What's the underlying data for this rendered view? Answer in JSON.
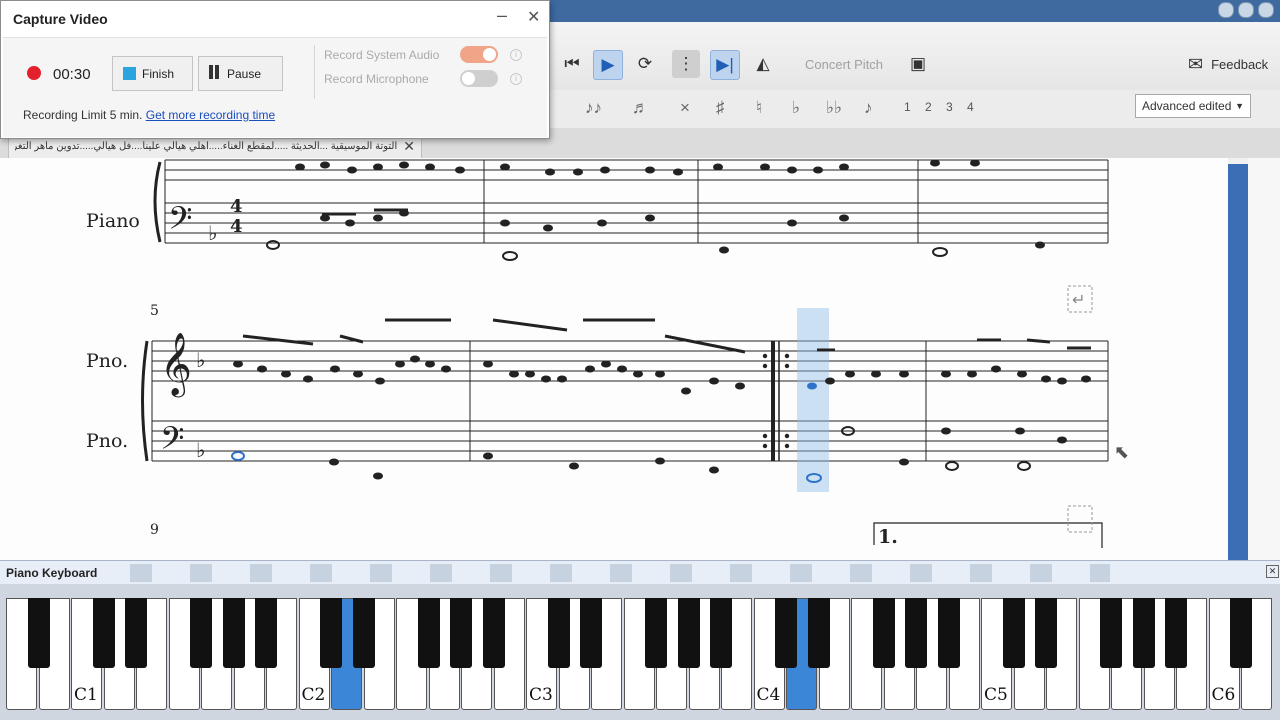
{
  "toolbar": {
    "concert_pitch": "Concert Pitch",
    "feedback": "Feedback",
    "mode_select": "Advanced edited",
    "voice_numbers": [
      "1",
      "2",
      "3",
      "4"
    ],
    "icons": [
      "rewind-to-start-icon",
      "play-icon",
      "loop-icon",
      "repeat-icon",
      "next-icon",
      "metronome-icon",
      "camera-icon",
      "envelope-icon"
    ]
  },
  "tab": {
    "title": "التوتة الموسيقية ...الحديثة .....لمقطع الغناء.....أهلي هيالي علينا....فل هيالي.....تدوين ماهر التغري"
  },
  "capture": {
    "title": "Capture Video",
    "time": "00:30",
    "finish": "Finish",
    "pause": "Pause",
    "record_system_audio": "Record System Audio",
    "record_microphone": "Record Microphone",
    "limit_text": "Recording Limit 5 min.",
    "more_link": "Get more recording time"
  },
  "score": {
    "instrument_full": "Piano",
    "instrument_abbr_top": "Pno.",
    "instrument_abbr_bottom": "Pno.",
    "measure_5": "5",
    "measure_9": "9",
    "volta": "1.",
    "time_sig_top": "4",
    "time_sig_bottom": "4"
  },
  "keyboard": {
    "title": "Piano Keyboard",
    "octave_labels": [
      "C1",
      "C2",
      "C3",
      "C4",
      "C5",
      "C6"
    ],
    "active_keys": [
      "D2",
      "D4"
    ]
  }
}
